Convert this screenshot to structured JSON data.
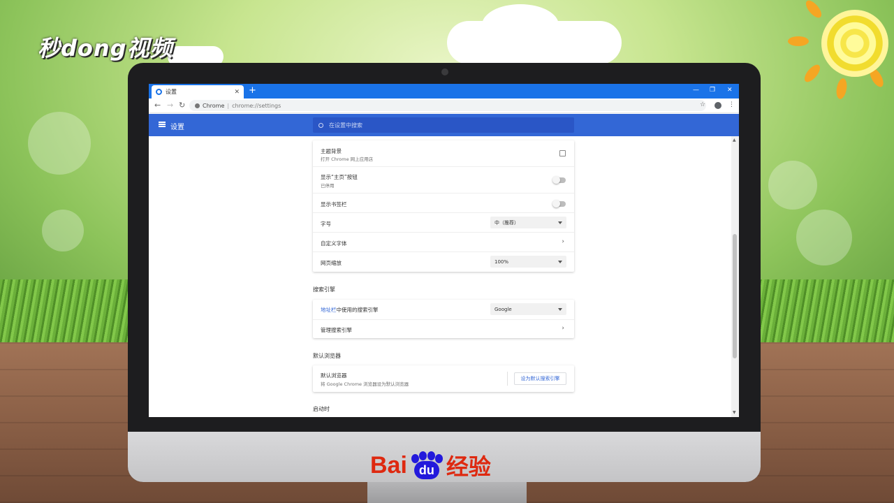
{
  "watermark": {
    "brand_top": "秒dong视频",
    "brand_bottom_bai": "Bai",
    "brand_bottom_du": "du",
    "brand_bottom_jy": "经验"
  },
  "colors": {
    "chrome_blue": "#1a73e8",
    "settings_header": "#3367d6",
    "link": "#3367d6"
  },
  "browser": {
    "tab_title": "设置",
    "tab_close": "✕",
    "new_tab": "+",
    "window_controls": [
      "—",
      "❐",
      "✕"
    ],
    "nav": {
      "back": "←",
      "forward": "→",
      "reload": "↻"
    },
    "omnibox": {
      "scheme": "Chrome",
      "separator": "|",
      "url": "chrome://settings"
    },
    "bookmark_star": "☆",
    "menu": "⋮"
  },
  "settings": {
    "header_title": "设置",
    "search_placeholder": "在设置中搜索",
    "appearance": {
      "theme": {
        "title": "主题背景",
        "subtitle": "打开 Chrome 网上应用店"
      },
      "home_button": {
        "title": "显示“主页”按钮",
        "subtitle": "已停用"
      },
      "bookmarks_bar": {
        "title": "显示书签栏"
      },
      "font_size": {
        "title": "字号",
        "value": "中（推荐）"
      },
      "custom_fonts": {
        "title": "自定义字体",
        "chevron": "›"
      },
      "page_zoom": {
        "title": "网页缩放",
        "value": "100%"
      }
    },
    "search_engine": {
      "section": "搜索引擎",
      "address_bar": {
        "link": "地址栏",
        "rest": "中使用的搜索引擎",
        "value": "Google"
      },
      "manage": {
        "title": "管理搜索引擎",
        "chevron": "›"
      }
    },
    "default_browser": {
      "section": "默认浏览器",
      "title": "默认浏览器",
      "subtitle": "将 Google Chrome 浏览器设为默认浏览器",
      "button": "设为默认搜索引擎"
    },
    "on_startup": {
      "section": "启动时"
    }
  }
}
